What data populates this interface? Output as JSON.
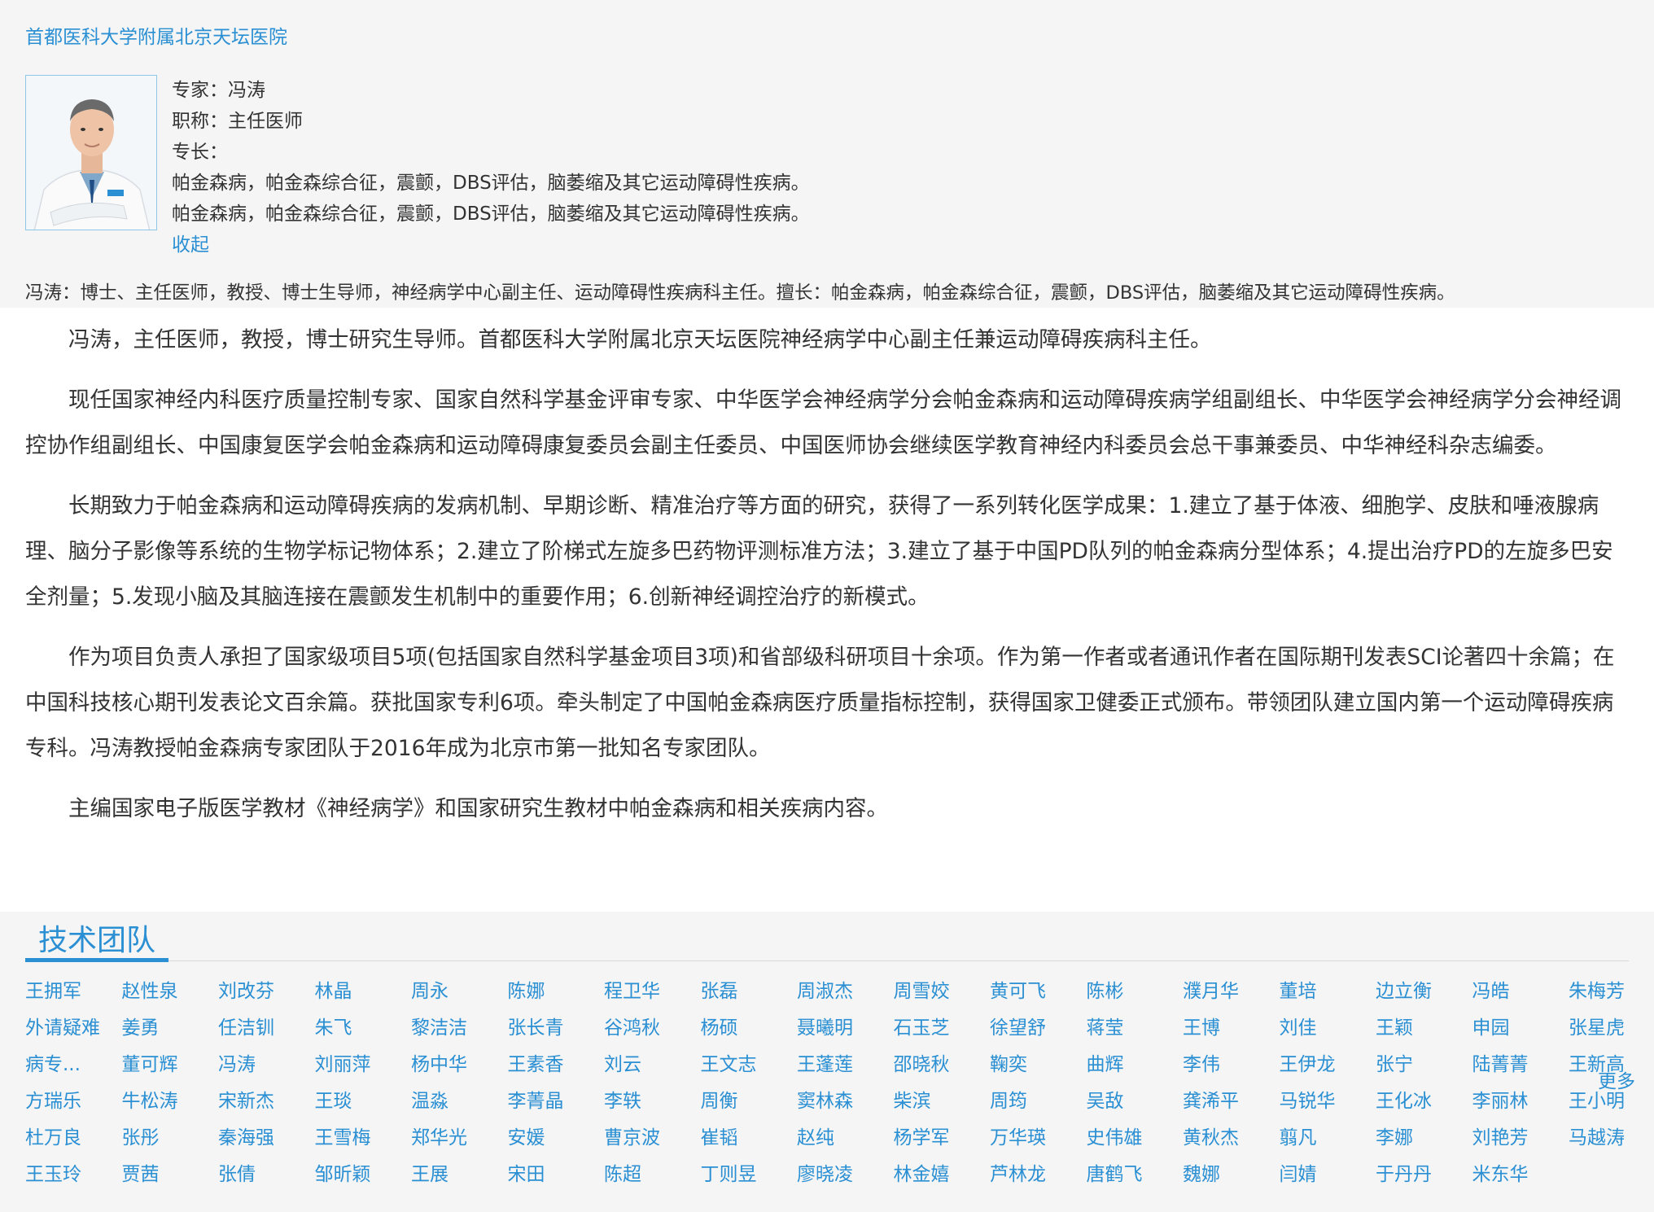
{
  "hospital": "首都医科大学附属北京天坛医院",
  "doctor": {
    "name_line": "专家：冯涛",
    "title_line": "职称：主任医师",
    "specialty_label": "专长：",
    "specialty_1": "帕金森病，帕金森综合征，震颤，DBS评估，脑萎缩及其它运动障碍性疾病。",
    "specialty_2": "帕金森病，帕金森综合征，震颤，DBS评估，脑萎缩及其它运动障碍性疾病。",
    "collapse": "收起",
    "summary": "冯涛：博士、主任医师，教授、博士生导师，神经病学中心副主任、运动障碍性疾病科主任。擅长：帕金森病，帕金森综合征，震颤，DBS评估，脑萎缩及其它运动障碍性疾病。"
  },
  "bio": [
    "冯涛，主任医师，教授，博士研究生导师。首都医科大学附属北京天坛医院神经病学中心副主任兼运动障碍疾病科主任。",
    "现任国家神经内科医疗质量控制专家、国家自然科学基金评审专家、中华医学会神经病学分会帕金森病和运动障碍疾病学组副组长、中华医学会神经病学分会神经调控协作组副组长、中国康复医学会帕金森病和运动障碍康复委员会副主任委员、中国医师协会继续医学教育神经内科委员会总干事兼委员、中华神经科杂志编委。",
    "长期致力于帕金森病和运动障碍疾病的发病机制、早期诊断、精准治疗等方面的研究，获得了一系列转化医学成果：1.建立了基于体液、细胞学、皮肤和唾液腺病理、脑分子影像等系统的生物学标记物体系；2.建立了阶梯式左旋多巴药物评测标准方法；3.建立了基于中国PD队列的帕金森病分型体系；4.提出治疗PD的左旋多巴安全剂量；5.发现小脑及其脑连接在震颤发生机制中的重要作用；6.创新神经调控治疗的新模式。",
    "作为项目负责人承担了国家级项目5项(包括国家自然科学基金项目3项)和省部级科研项目十余项。作为第一作者或者通讯作者在国际期刊发表SCI论著四十余篇；在中国科技核心期刊发表论文百余篇。获批国家专利6项。牵头制定了中国帕金森病医疗质量指标控制，获得国家卫健委正式颁布。带领团队建立国内第一个运动障碍疾病专科。冯涛教授帕金森病专家团队于2016年成为北京市第一批知名专家团队。",
    "主编国家电子版医学教材《神经病学》和国家研究生教材中帕金森病和相关疾病内容。"
  ],
  "team": {
    "title": "技术团队",
    "more": "更多",
    "rows": [
      [
        "王拥军",
        "赵性泉",
        "刘改芬",
        "林晶",
        "周永",
        "陈娜",
        "程卫华",
        "张磊",
        "周淑杰",
        "周雪姣",
        "黄可飞",
        "陈彬",
        "濮月华",
        "董培",
        "边立衡",
        "冯皓",
        "朱梅芳"
      ],
      [
        "外请疑难",
        "姜勇",
        "任洁钏",
        "朱飞",
        "黎洁洁",
        "张长青",
        "谷鸿秋",
        "杨硕",
        "聂曦明",
        "石玉芝",
        "徐望舒",
        "蒋莹",
        "王博",
        "刘佳",
        "王颖",
        "申园",
        "张星虎"
      ],
      [
        "病专...",
        "董可辉",
        "冯涛",
        "刘丽萍",
        "杨中华",
        "王素香",
        "刘云",
        "王文志",
        "王蓬莲",
        "邵晓秋",
        "鞠奕",
        "曲辉",
        "李伟",
        "王伊龙",
        "张宁",
        "陆菁菁",
        "王新高"
      ],
      [
        "方瑞乐",
        "牛松涛",
        "宋新杰",
        "王琰",
        "温淼",
        "李菁晶",
        "李轶",
        "周衡",
        "窦林森",
        "柴滨",
        "周筠",
        "吴敌",
        "龚浠平",
        "马锐华",
        "王化冰",
        "李丽林",
        "王小明"
      ],
      [
        "杜万良",
        "张彤",
        "秦海强",
        "王雪梅",
        "郑华光",
        "安媛",
        "曹京波",
        "崔韬",
        "赵纯",
        "杨学军",
        "万华瑛",
        "史伟雄",
        "黄秋杰",
        "翦凡",
        "李娜",
        "刘艳芳",
        "马越涛"
      ],
      [
        "王玉玲",
        "贾茜",
        "张倩",
        "邹昕颖",
        "王展",
        "宋田",
        "陈超",
        "丁则昱",
        "廖晓凌",
        "林金嬉",
        "芦林龙",
        "唐鹤飞",
        "魏娜",
        "闫婧",
        "于丹丹",
        "米东华"
      ]
    ]
  }
}
